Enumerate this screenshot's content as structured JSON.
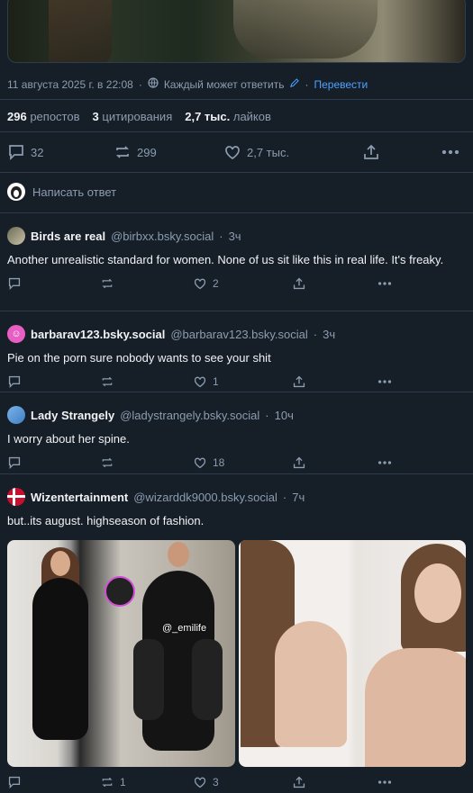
{
  "post": {
    "timestamp": "11 августа 2025 г. в 22:08",
    "audience": "Каждый может ответить",
    "translate": "Перевести",
    "stats": {
      "reposts_count": "296",
      "reposts_label": "репостов",
      "quotes_count": "3",
      "quotes_label": "цитирования",
      "likes_count": "2,7 тыс.",
      "likes_label": "лайков"
    },
    "actions": {
      "replies": "32",
      "reposts": "299",
      "likes": "2,7 тыс."
    },
    "reply_placeholder": "Написать ответ"
  },
  "replies": [
    {
      "name": "Birds are real",
      "handle": "@birbxx.bsky.social",
      "time": "3ч",
      "text": "Another unrealistic standard for women. None of us sit like this in real life. It's freaky.",
      "reply_count": "",
      "repost_count": "",
      "like_count": "2"
    },
    {
      "name": "barbarav123.bsky.social",
      "handle": "@barbarav123.bsky.social",
      "time": "3ч",
      "text": "Pie on the porn sure nobody wants to see your shit",
      "reply_count": "",
      "repost_count": "",
      "like_count": "1"
    },
    {
      "name": "Lady Strangely",
      "handle": "@ladystrangely.bsky.social",
      "time": "10ч",
      "text": "I worry about her spine.",
      "reply_count": "",
      "repost_count": "",
      "like_count": "18"
    },
    {
      "name": "Wizentertainment",
      "handle": "@wizarddk9000.bsky.social",
      "time": "7ч",
      "text": "but..its august. highseason of fashion.",
      "image_tag": "@_emilife",
      "reply_count": "",
      "repost_count": "1",
      "like_count": "3"
    }
  ],
  "colors": {
    "background": "#161e27",
    "divider": "#2e3d4e",
    "muted": "#8c9db1",
    "link": "#4da3ff"
  }
}
